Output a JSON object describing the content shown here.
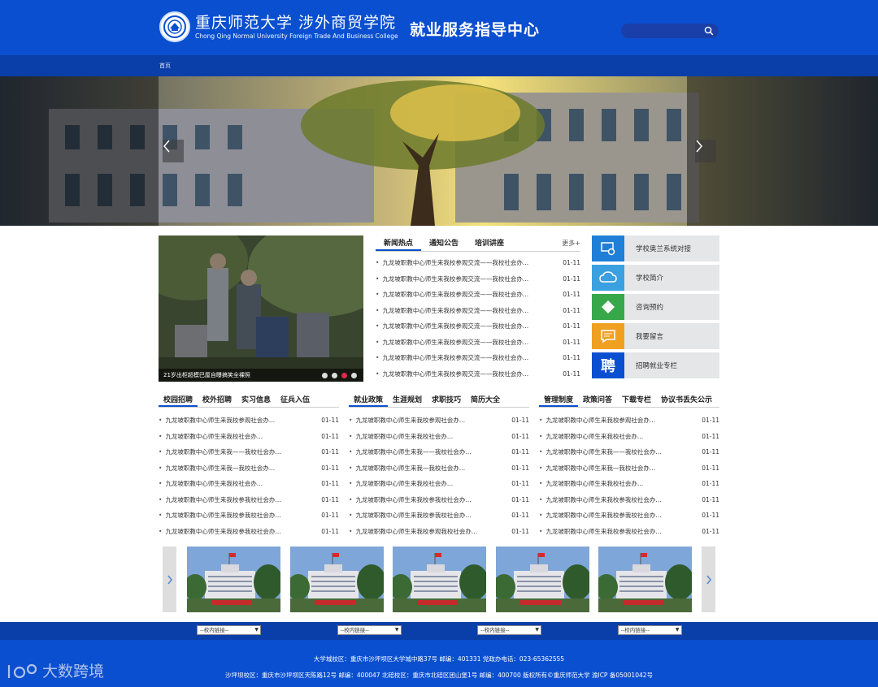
{
  "header": {
    "logo_cn": "重庆师范大学 涉外商贸学院",
    "logo_en": "Chong Qing Normal University Foreign Trade And Business College",
    "center_title": "就业服务指导中心",
    "search_placeholder": ""
  },
  "nav": {
    "home": "首页"
  },
  "slideshow": {
    "caption": "21岁出柜超模巴厘自曝搞笑全裸照",
    "dots": 4,
    "active_dot": 3
  },
  "news_tabs": {
    "tabs": [
      "新闻热点",
      "通知公告",
      "培训讲座"
    ],
    "more": "更多+",
    "rows": [
      {
        "t": "九龙坡职教中心师生来我校参观交流——我校社会办...",
        "d": "01-11"
      },
      {
        "t": "九龙坡职教中心师生来我校参观交流——我校社会办...",
        "d": "01-11"
      },
      {
        "t": "九龙坡职教中心师生来我校参观交流——我校社会办...",
        "d": "01-11"
      },
      {
        "t": "九龙坡职教中心师生来我校参观交流——我校社会办...",
        "d": "01-11"
      },
      {
        "t": "九龙坡职教中心师生来我校参观交流——我校社会办...",
        "d": "01-11"
      },
      {
        "t": "九龙坡职教中心师生来我校参观交流——我校社会办...",
        "d": "01-11"
      },
      {
        "t": "九龙坡职教中心师生来我校参观交流——我校社会办...",
        "d": "01-11"
      },
      {
        "t": "九龙坡职教中心师生来我校参观交流——我校社会办...",
        "d": "01-11"
      }
    ]
  },
  "side_links": [
    {
      "label": "学校奥兰系统对接",
      "color": "#1f7fd6",
      "icon": "gear-screen-icon"
    },
    {
      "label": "学校简介",
      "color": "#3aa0e0",
      "icon": "cloud-icon"
    },
    {
      "label": "咨询预约",
      "color": "#37a84a",
      "icon": "puzzle-icon"
    },
    {
      "label": "我要留言",
      "color": "#f0a020",
      "icon": "message-icon"
    },
    {
      "label": "招聘就业专栏",
      "color": "#0a4fd0",
      "icon": "recruit-icon"
    }
  ],
  "recruit_glyph": "聘",
  "columns": [
    {
      "tabs": [
        "校园招聘",
        "校外招聘",
        "实习信息",
        "征兵入伍"
      ],
      "rows": [
        {
          "t": "九龙坡职教中心师生来我校参观社会办...",
          "d": "01-11"
        },
        {
          "t": "九龙坡职教中心师生来我校社会办...",
          "d": "01-11"
        },
        {
          "t": "九龙坡职教中心师生来我——我校社会办...",
          "d": "01-11"
        },
        {
          "t": "九龙坡职教中心师生来我—我校社会办...",
          "d": "01-11"
        },
        {
          "t": "九龙坡职教中心师生来我校社会办...",
          "d": "01-11"
        },
        {
          "t": "九龙坡职教中心师生来我校参我校社会办...",
          "d": "01-11"
        },
        {
          "t": "九龙坡职教中心师生来我校参我校社会办...",
          "d": "01-11"
        },
        {
          "t": "九龙坡职教中心师生来我校参我校社会办...",
          "d": "01-11"
        }
      ]
    },
    {
      "tabs": [
        "就业政策",
        "生涯规划",
        "求职技巧",
        "简历大全"
      ],
      "rows": [
        {
          "t": "九龙坡职教中心师生来我校参观社会办...",
          "d": "01-11"
        },
        {
          "t": "九龙坡职教中心师生来我校社会办...",
          "d": "01-11"
        },
        {
          "t": "九龙坡职教中心师生来我——我校社会办...",
          "d": "01-11"
        },
        {
          "t": "九龙坡职教中心师生来我—我校社会办...",
          "d": "01-11"
        },
        {
          "t": "九龙坡职教中心师生来我校社会办...",
          "d": "01-11"
        },
        {
          "t": "九龙坡职教中心师生来我校参我校社会办...",
          "d": "01-11"
        },
        {
          "t": "九龙坡职教中心师生来我校参我校社会办...",
          "d": "01-11"
        },
        {
          "t": "九龙坡职教中心师生来我校参观我校社会办...",
          "d": "01-11"
        }
      ]
    },
    {
      "tabs": [
        "管理制度",
        "政策问答",
        "下载专栏",
        "协议书丢失公示"
      ],
      "rows": [
        {
          "t": "九龙坡职教中心师生来我校参观社会办...",
          "d": "01-11"
        },
        {
          "t": "九龙坡职教中心师生来我校社会办...",
          "d": "01-11"
        },
        {
          "t": "九龙坡职教中心师生来我——我校社会办...",
          "d": "01-11"
        },
        {
          "t": "九龙坡职教中心师生来我—我校社会办...",
          "d": "01-11"
        },
        {
          "t": "九龙坡职教中心师生来我校社会办...",
          "d": "01-11"
        },
        {
          "t": "九龙坡职教中心师生来我校参我校社会办...",
          "d": "01-11"
        },
        {
          "t": "九龙坡职教中心师生来我校参我校社会办...",
          "d": "01-11"
        },
        {
          "t": "九龙坡职教中心师生来我校参我校社会办...",
          "d": "01-11"
        }
      ]
    }
  ],
  "thumb_count": 5,
  "footer_selects": [
    "--校内链接--",
    "--校内链接--",
    "--校内链接--",
    "--校内链接--"
  ],
  "footer": {
    "line1": "大学城校区：重庆市沙坪坝区大学城中路37号 邮编：401331 党政办电话：023-65362555",
    "line2": "沙坪坝校区：重庆市沙坪坝区天陈路12号 邮编：400047 北碚校区：重庆市北碚区团山堡1号 邮编：400700 版权所有©重庆师范大学 渝ICP 备05001042号"
  },
  "watermark": "大数跨境",
  "colors": {
    "brand_blue": "#0a4fd0",
    "nav_blue": "#0a3ea8",
    "dot_active": "#e0294a"
  }
}
